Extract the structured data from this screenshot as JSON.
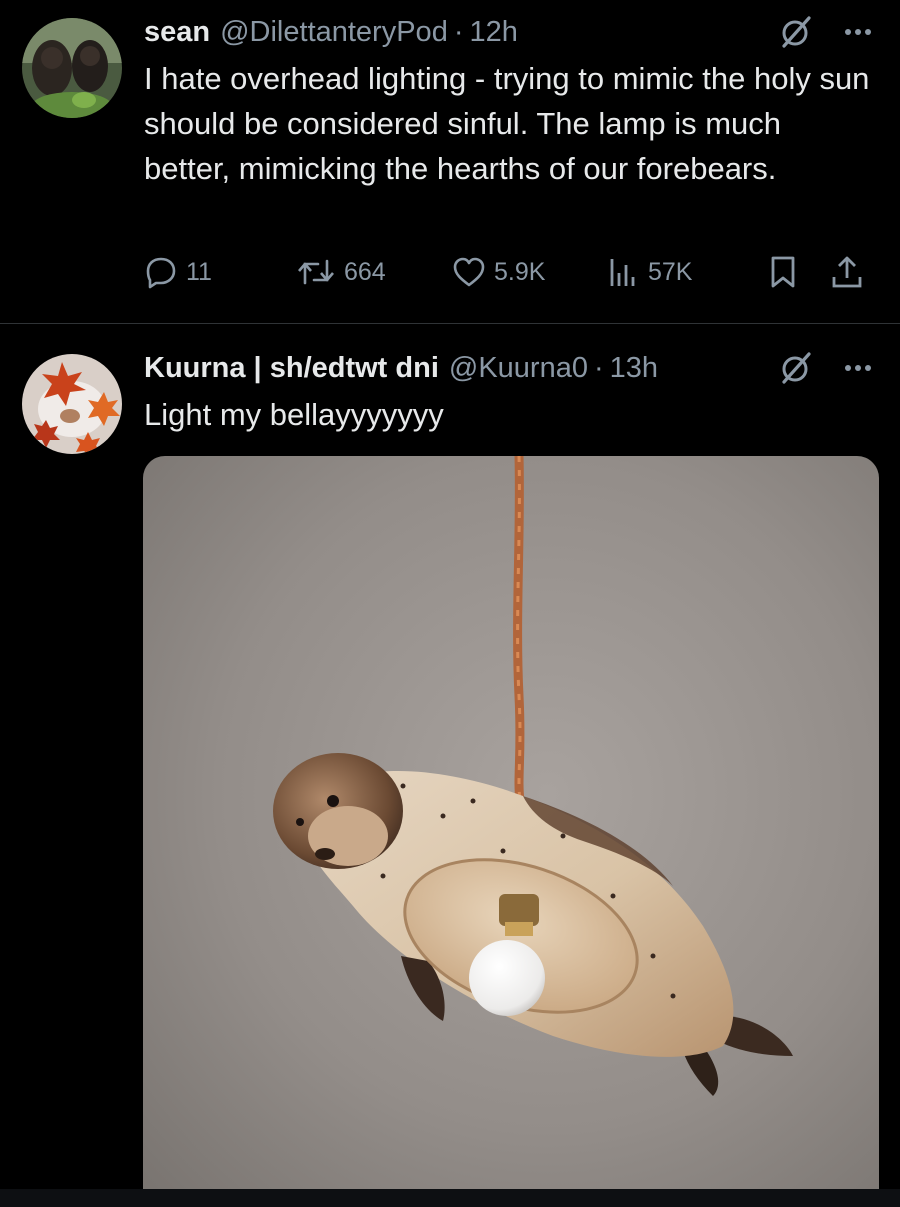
{
  "tweets": [
    {
      "author": "sean",
      "handle": "@DilettanteryPod",
      "separator": "·",
      "time": "12h",
      "text": "I hate overhead lighting - trying to mimic the holy sun should be considered sinful. The lamp is much better, mimicking the hearths of our forebears.",
      "metrics": {
        "replies": "11",
        "reposts": "664",
        "likes": "5.9K",
        "views": "57K"
      }
    },
    {
      "author": "Kuurna | sh/edtwt dni",
      "handle": "@Kuurna0",
      "separator": "·",
      "time": "13h",
      "text": "Light my bellayyyyyyy"
    }
  ],
  "icons": {
    "reply": "reply-icon",
    "repost": "repost-icon",
    "like": "heart-icon",
    "views": "views-chart-icon",
    "bookmark": "bookmark-icon",
    "share": "share-icon",
    "grok": "grok-icon",
    "more": "more-dots-icon"
  },
  "colors": {
    "background": "#000000",
    "text": "#e7e9ea",
    "secondary": "#8b98a5",
    "divider": "#2f3336"
  }
}
